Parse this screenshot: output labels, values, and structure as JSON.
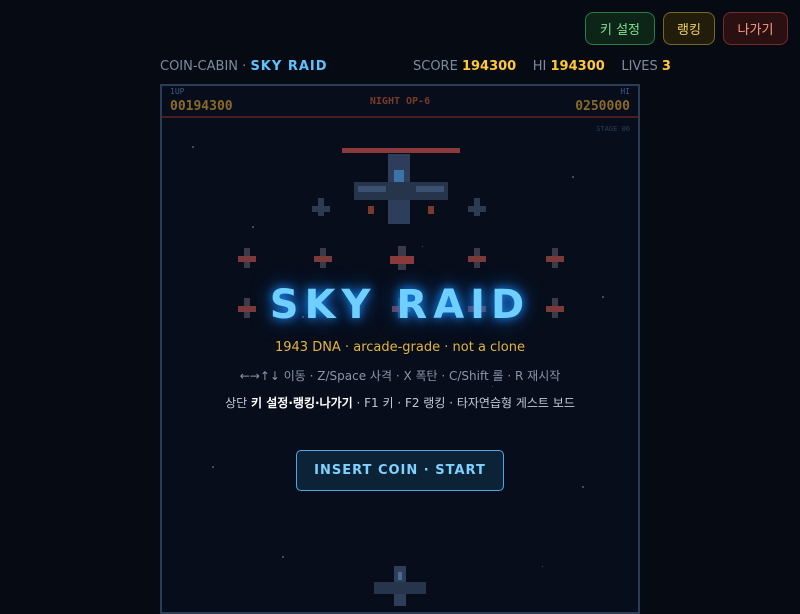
{
  "top_buttons": {
    "keys": "키 설정",
    "ranking": "랭킹",
    "exit": "나가기"
  },
  "hud": {
    "cabin": "COIN-CABIN",
    "dot": "·",
    "game": "SKY RAID",
    "score_label": "SCORE",
    "score": "194300",
    "hi_label": "HI",
    "hi": "194300",
    "lives_label": "LIVES",
    "lives": "3"
  },
  "screen": {
    "p1_label": "1UP",
    "p1_score": "00194300",
    "stage": "NIGHT OP-6",
    "hi_label": "HI",
    "hi_score": "0250000",
    "sub_label": "STAGE 06"
  },
  "overlay": {
    "title": "SKY RAID",
    "tagline": "1943 DNA · arcade-grade · not a clone",
    "controls": "←→↑↓ 이동 · Z/Space 사격 · X 폭탄 · C/Shift 롤 · R 재시작",
    "info_prefix": "상단 ",
    "info_bold": "키 설정·랭킹·나가기",
    "info_suffix": " · F1 키 · F2 랭킹 · 타자연습형 게스트 보드",
    "start": "INSERT COIN · START"
  },
  "colors": {
    "accent": "#5cc4ff",
    "gold": "#ffc83a",
    "bg": "#060a13"
  }
}
